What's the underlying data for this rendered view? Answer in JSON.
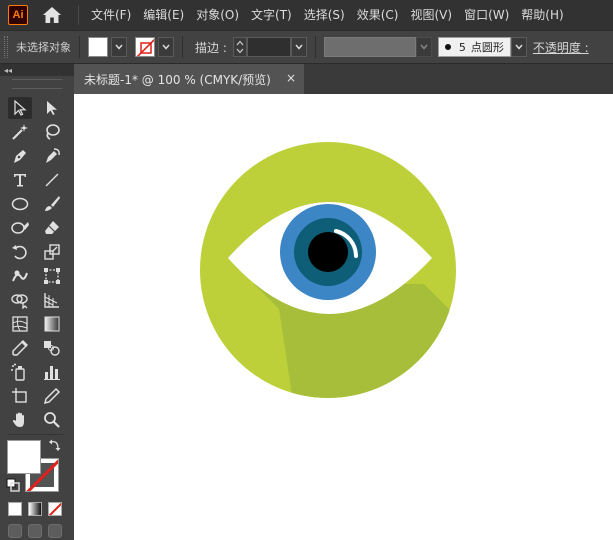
{
  "app": {
    "logo_text": "Ai"
  },
  "menu": [
    "文件(F)",
    "编辑(E)",
    "对象(O)",
    "文字(T)",
    "选择(S)",
    "效果(C)",
    "视图(V)",
    "窗口(W)",
    "帮助(H)"
  ],
  "control_bar": {
    "selection_status": "未选择对象",
    "stroke_label": "描边 :",
    "brush_size": "5",
    "brush_name": "点圆形",
    "opacity_label": "不透明度 :"
  },
  "toolbar": {
    "collapse_glyph": "◂◂"
  },
  "document_tab": {
    "title": "未标题-1* @ 100 % (CMYK/预览)",
    "close": "×"
  },
  "colors": {
    "circle": "#BDD03A",
    "shadow": "#A6BE3A",
    "eye_white": "#FFFFFF",
    "iris_outer": "#3D86C6",
    "iris_inner": "#0E5E77",
    "pupil": "#000000",
    "canvas": "#FFFFFF",
    "ui_dark": "#323232",
    "ui_mid": "#424242",
    "ui_workspace": "#535353",
    "stroke_none": "#E0201A"
  },
  "icons": [
    "selection-tool",
    "direct-selection-tool",
    "magic-wand-tool",
    "lasso-tool",
    "pen-tool",
    "curvature-tool",
    "type-tool",
    "line-segment-tool",
    "ellipse-tool",
    "paintbrush-tool",
    "shaper-tool",
    "eraser-tool",
    "rotate-tool",
    "scale-tool",
    "warp-tool",
    "free-transform-tool",
    "shape-builder-tool",
    "perspective-grid-tool",
    "mesh-tool",
    "gradient-tool",
    "eyedropper-tool",
    "blend-tool",
    "symbol-sprayer-tool",
    "column-graph-tool",
    "artboard-tool",
    "slice-tool",
    "hand-tool",
    "zoom-tool"
  ]
}
